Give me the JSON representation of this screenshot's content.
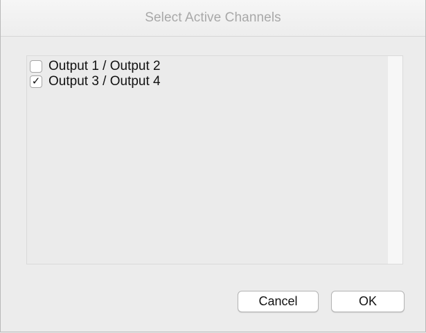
{
  "dialog": {
    "title": "Select Active Channels"
  },
  "channels": [
    {
      "label": "Output 1 / Output 2",
      "checked": false,
      "check_glyph": ""
    },
    {
      "label": "Output 3 / Output 4",
      "checked": true,
      "check_glyph": "✓"
    }
  ],
  "buttons": {
    "cancel_label": "Cancel",
    "ok_label": "OK"
  }
}
